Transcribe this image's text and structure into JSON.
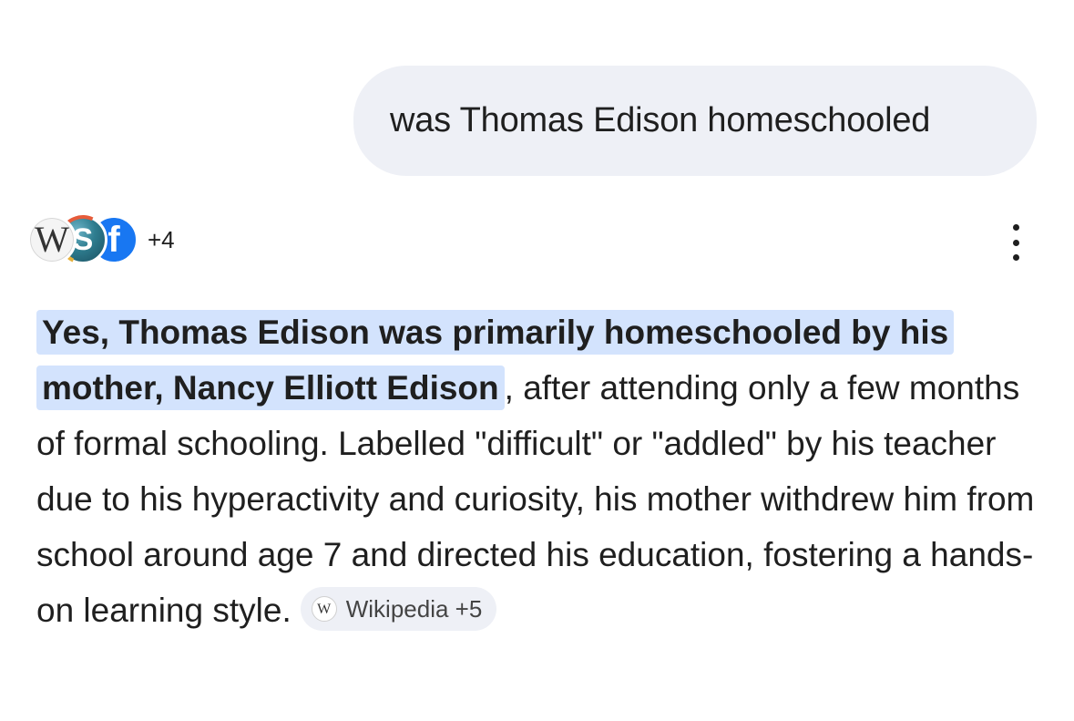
{
  "query": {
    "text": "was Thomas Edison homeschooled"
  },
  "sources": {
    "icons": [
      {
        "name": "wikipedia-icon",
        "glyph": "W"
      },
      {
        "name": "s-site-icon",
        "glyph": "S"
      },
      {
        "name": "facebook-icon",
        "glyph": "f"
      }
    ],
    "more_count": "+4"
  },
  "answer": {
    "highlight": "Yes, Thomas Edison was primarily homeschooled by his mother, Nancy Elliott Edison",
    "body": ", after attending only a few months of formal schooling. Labelled \"difficult\" or \"addled\" by his teacher due to his hyperactivity and curiosity, his mother withdrew him from school around age 7 and directed his education, fostering a hands-on learning style.",
    "citation": {
      "icon_glyph": "W",
      "label": "Wikipedia +5"
    }
  },
  "colors": {
    "bubble_bg": "#eef0f6",
    "highlight_bg": "#d3e3fd",
    "facebook_blue": "#1877f2",
    "text": "#1f1f1f"
  }
}
